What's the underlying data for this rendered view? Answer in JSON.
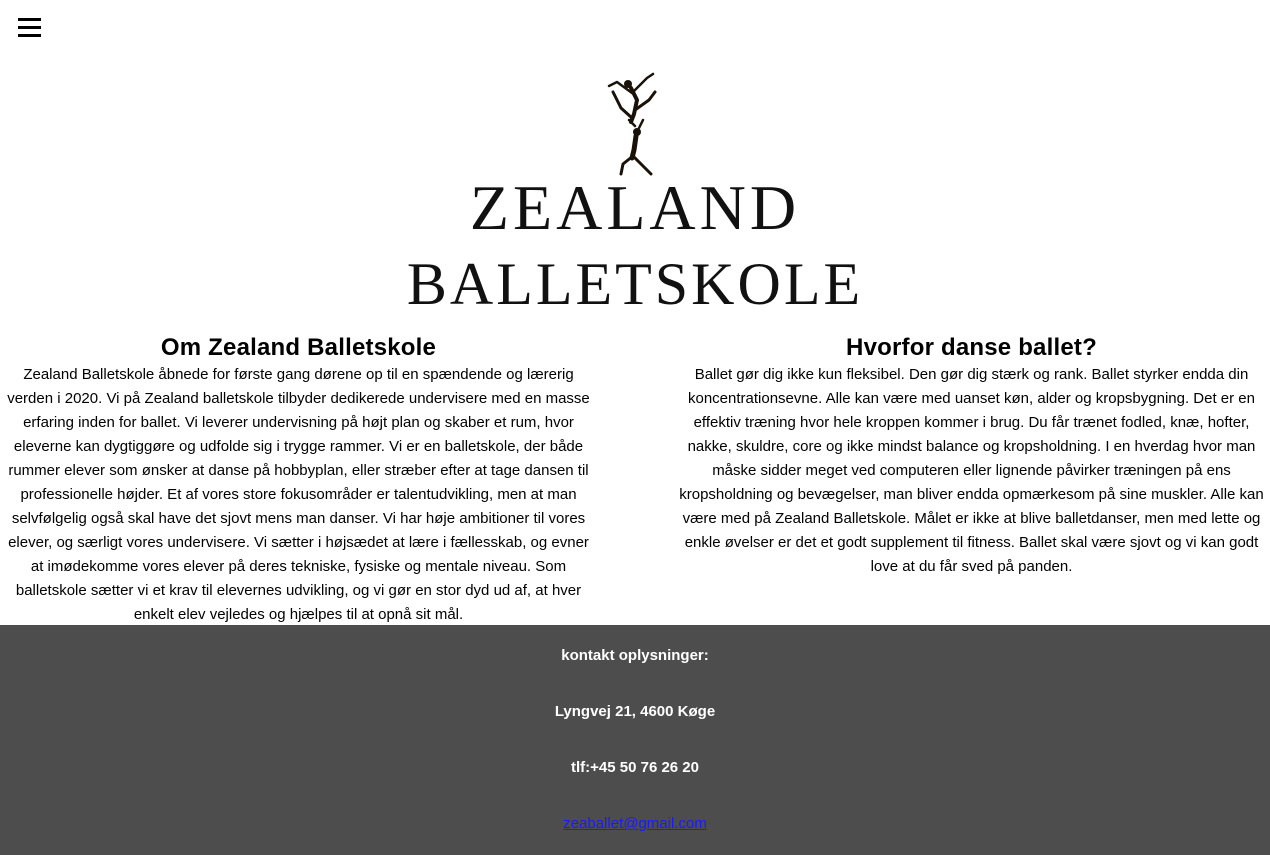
{
  "header": {
    "menu_icon": "hamburger-menu-icon"
  },
  "logo": {
    "line1": "ZEALAND",
    "line2": "BALLETSKOLE",
    "figure": "ballet-dancers-silhouette"
  },
  "about": {
    "title": "Om Zealand Balletskole",
    "text": "Zealand Balletskole åbnede for første gang dørene op til en spændende og lærerig verden i 2020. Vi på Zealand balletskole tilbyder dedikerede undervisere med en masse erfaring inden for ballet. Vi leverer undervisning på højt plan og skaber et rum, hvor eleverne kan dygtiggøre og udfolde sig i trygge rammer. Vi er en balletskole, der både rummer elever som ønsker at danse på hobbyplan, eller stræber efter at tage dansen til professionelle højder. Et af vores store fokusområder er talentudvikling, men at man selvfølgelig også skal have det sjovt mens man danser. Vi har høje ambitioner til vores elever, og særligt vores undervisere. Vi sætter i højsædet at lære i fællesskab, og evner at imødekomme vores elever på deres tekniske, fysiske og mentale niveau. Som balletskole sætter vi et krav til elevernes udvikling, og vi gør en stor dyd ud af, at hver enkelt elev vejledes og hjælpes til at opnå sit mål."
  },
  "why": {
    "title": "Hvorfor danse ballet?",
    "text": "Ballet gør dig ikke kun fleksibel. Den gør dig stærk og rank. Ballet styrker endda din koncentrationsevne. Alle kan være med uanset køn, alder og kropsbygning. Det er en effektiv træning hvor hele kroppen kommer i brug. Du får trænet fodled, knæ, hofter, nakke, skuldre, core og ikke mindst balance og kropsholdning. I en hverdag hvor man måske sidder meget ved computeren eller lignende påvirker træningen på ens kropsholdning og bevægelser, man bliver endda opmærkesom på sine muskler. Alle kan være med på Zealand Balletskole. Målet er ikke at blive balletdanser, men med lette og enkle øvelser er det et godt supplement til fitness. Ballet skal være sjovt og vi kan godt love at du får sved på panden."
  },
  "footer": {
    "heading": "kontakt oplysninger:",
    "address": "Lyngvej 21, 4600 Køge",
    "phone": "tlf:+45 50 76 26 20",
    "email": "zeaballet@gmail.com",
    "background_color": "#4d4d4d",
    "link_color": "#1a1aff"
  }
}
